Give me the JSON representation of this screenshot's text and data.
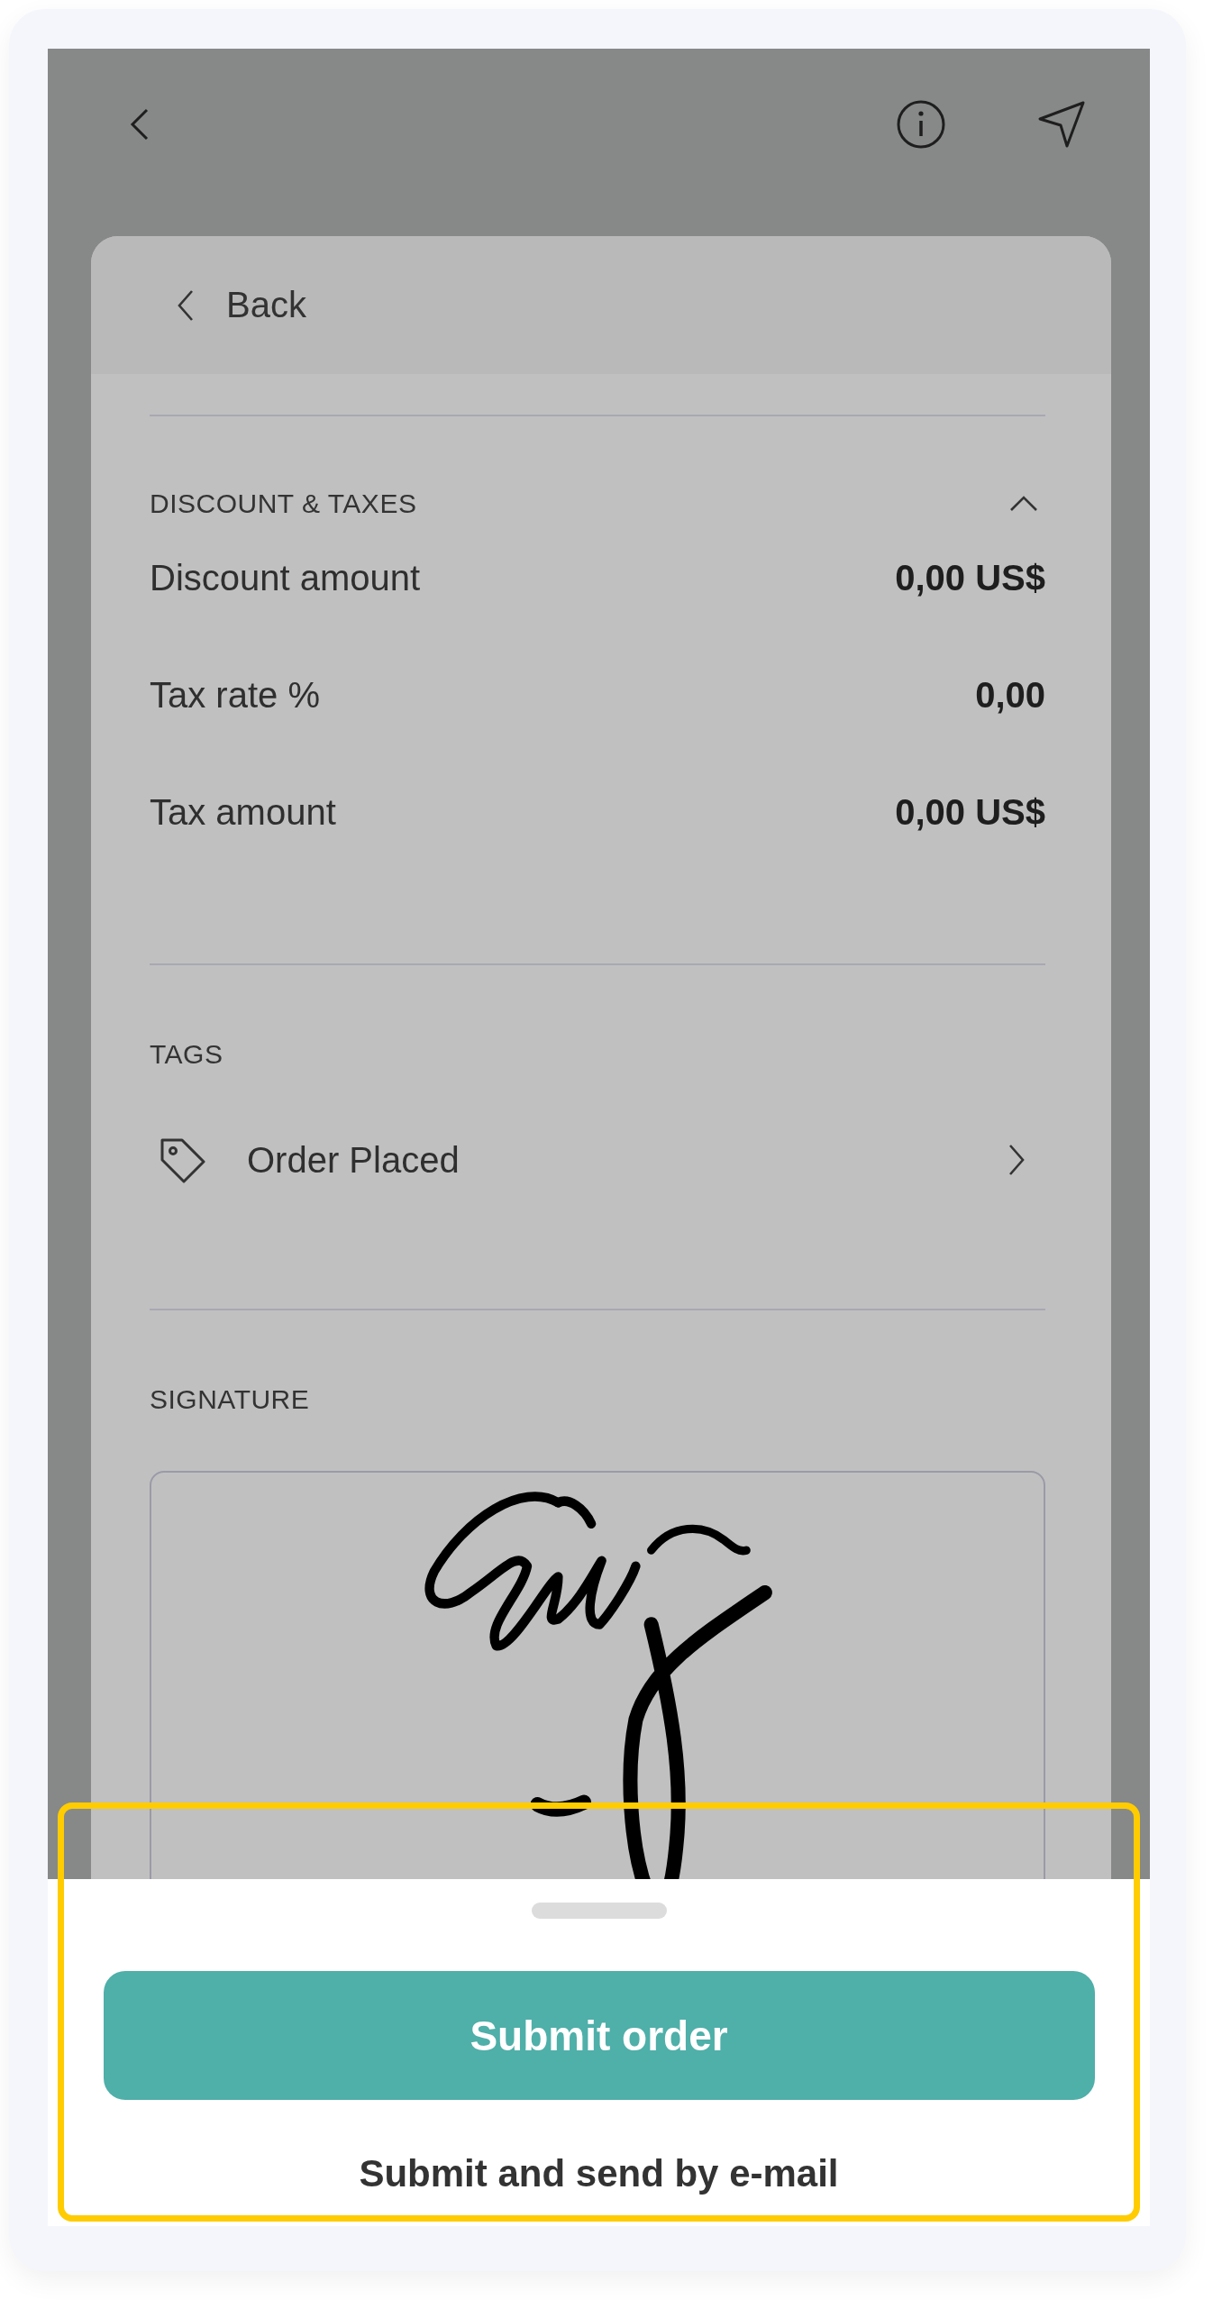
{
  "modal": {
    "back_label": "Back"
  },
  "discount_taxes": {
    "title": "DISCOUNT & TAXES",
    "expanded": true,
    "rows": [
      {
        "label": "Discount amount",
        "value": "0,00 US$"
      },
      {
        "label": "Tax rate %",
        "value": "0,00"
      },
      {
        "label": "Tax amount",
        "value": "0,00 US$"
      }
    ]
  },
  "tags": {
    "title": "TAGS",
    "items": [
      {
        "label": "Order Placed"
      }
    ]
  },
  "signature": {
    "title": "SIGNATURE"
  },
  "bottom_sheet": {
    "primary_button": "Submit order",
    "secondary_button": "Submit and send by e-mail"
  }
}
